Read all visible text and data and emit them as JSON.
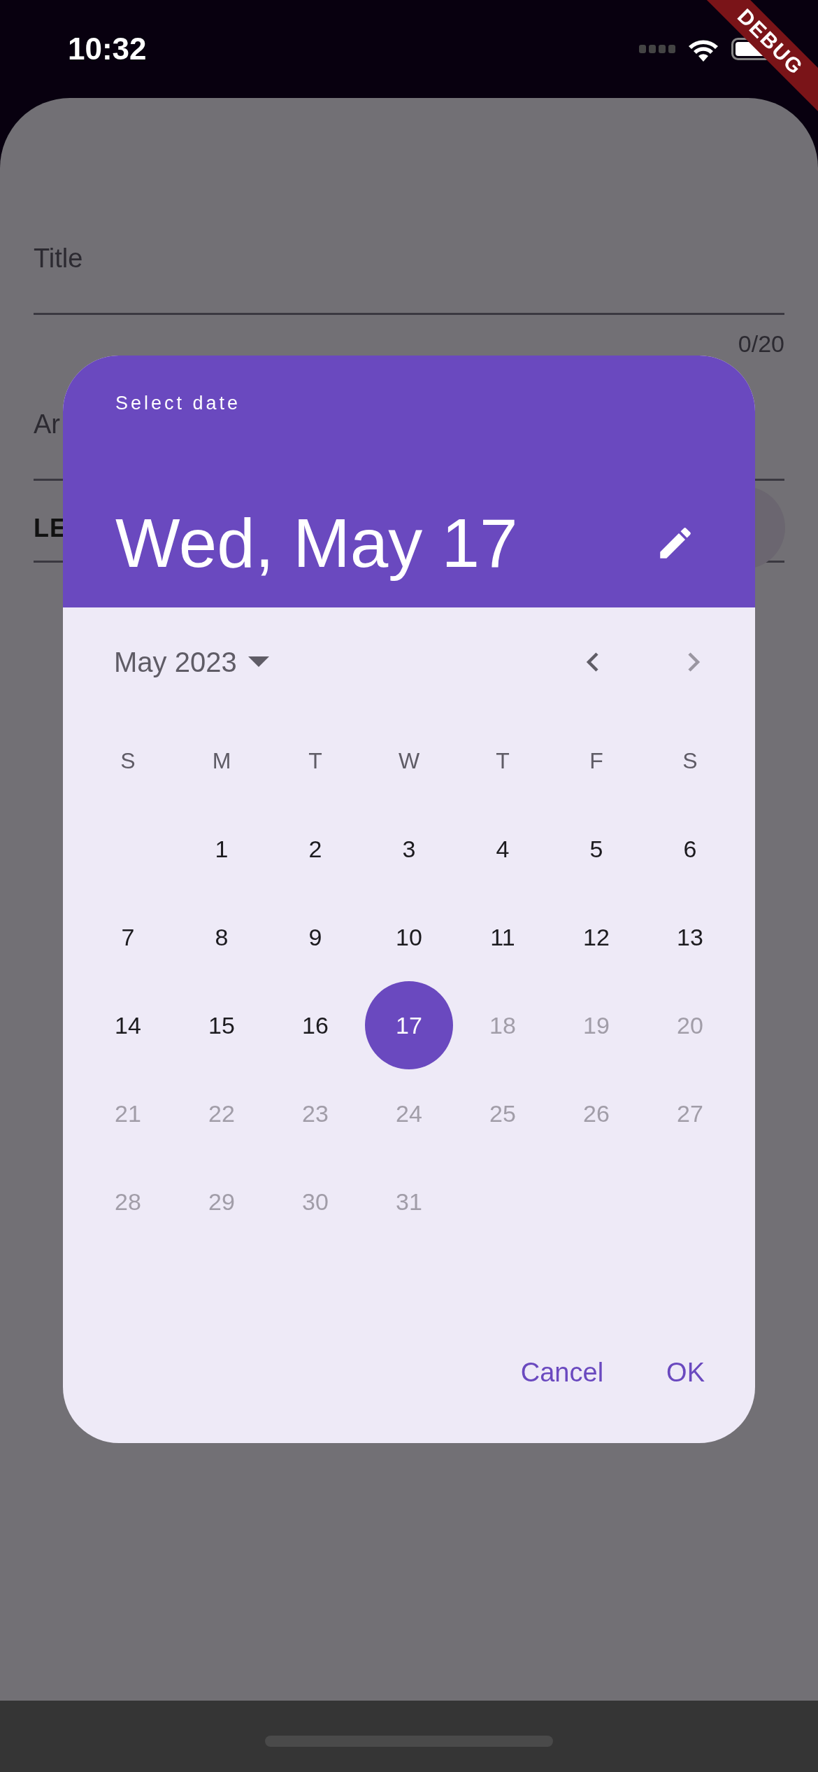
{
  "status_bar": {
    "time": "10:32"
  },
  "debug_banner": {
    "label": "DEBUG"
  },
  "form": {
    "fields": [
      {
        "kind": "label",
        "label": "Title",
        "counter": "0/20"
      },
      {
        "kind": "label",
        "label": "Ar"
      },
      {
        "kind": "value",
        "label": "LE"
      }
    ]
  },
  "dialog": {
    "title": "Select date",
    "selected_date": "Wed, May 17",
    "month_label": "May 2023",
    "previous_month": {
      "disabled": false
    },
    "next_month": {
      "disabled": true
    },
    "weekdays": [
      "S",
      "M",
      "T",
      "W",
      "T",
      "F",
      "S"
    ],
    "weeks": [
      [
        {
          "day": "1",
          "selected": false,
          "disabled": false
        },
        {
          "day": "2",
          "selected": false,
          "disabled": false
        },
        {
          "day": "3",
          "selected": false,
          "disabled": false
        },
        {
          "day": "4",
          "selected": false,
          "disabled": false
        },
        {
          "day": "5",
          "selected": false,
          "disabled": false
        },
        {
          "day": "6",
          "selected": false,
          "disabled": false
        }
      ],
      [
        {
          "day": "7",
          "selected": false,
          "disabled": false
        },
        {
          "day": "8",
          "selected": false,
          "disabled": false
        },
        {
          "day": "9",
          "selected": false,
          "disabled": false
        },
        {
          "day": "10",
          "selected": false,
          "disabled": false
        },
        {
          "day": "11",
          "selected": false,
          "disabled": false
        },
        {
          "day": "12",
          "selected": false,
          "disabled": false
        },
        {
          "day": "13",
          "selected": false,
          "disabled": false
        }
      ],
      [
        {
          "day": "14",
          "selected": false,
          "disabled": false
        },
        {
          "day": "15",
          "selected": false,
          "disabled": false
        },
        {
          "day": "16",
          "selected": false,
          "disabled": false
        },
        {
          "day": "17",
          "selected": true,
          "disabled": false
        },
        {
          "day": "18",
          "selected": false,
          "disabled": true
        },
        {
          "day": "19",
          "selected": false,
          "disabled": true
        },
        {
          "day": "20",
          "selected": false,
          "disabled": true
        }
      ],
      [
        {
          "day": "21",
          "selected": false,
          "disabled": true
        },
        {
          "day": "22",
          "selected": false,
          "disabled": true
        },
        {
          "day": "23",
          "selected": false,
          "disabled": true
        },
        {
          "day": "24",
          "selected": false,
          "disabled": true
        },
        {
          "day": "25",
          "selected": false,
          "disabled": true
        },
        {
          "day": "26",
          "selected": false,
          "disabled": true
        },
        {
          "day": "27",
          "selected": false,
          "disabled": true
        }
      ],
      [
        {
          "day": "28",
          "selected": false,
          "disabled": true
        },
        {
          "day": "29",
          "selected": false,
          "disabled": true
        },
        {
          "day": "30",
          "selected": false,
          "disabled": true
        },
        {
          "day": "31",
          "selected": false,
          "disabled": true
        }
      ]
    ],
    "buttons": [
      "Cancel",
      "OK"
    ]
  }
}
